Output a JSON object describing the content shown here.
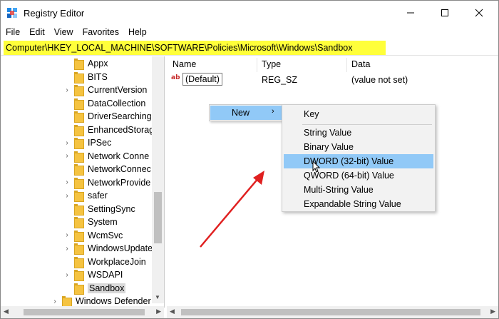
{
  "window": {
    "title": "Registry Editor"
  },
  "menubar": {
    "items": [
      "File",
      "Edit",
      "View",
      "Favorites",
      "Help"
    ]
  },
  "address": {
    "path": "Computer\\HKEY_LOCAL_MACHINE\\SOFTWARE\\Policies\\Microsoft\\Windows\\Sandbox",
    "highlight_color": "#ffff3a"
  },
  "tree": {
    "items": [
      {
        "label": "Appx",
        "expandable": false
      },
      {
        "label": "BITS",
        "expandable": false
      },
      {
        "label": "CurrentVersion",
        "expandable": true
      },
      {
        "label": "DataCollection",
        "expandable": false
      },
      {
        "label": "DriverSearching",
        "expandable": false
      },
      {
        "label": "EnhancedStorag",
        "expandable": false
      },
      {
        "label": "IPSec",
        "expandable": true
      },
      {
        "label": "Network Conne",
        "expandable": true
      },
      {
        "label": "NetworkConnec",
        "expandable": false
      },
      {
        "label": "NetworkProvide",
        "expandable": true
      },
      {
        "label": "safer",
        "expandable": true
      },
      {
        "label": "SettingSync",
        "expandable": false
      },
      {
        "label": "System",
        "expandable": false
      },
      {
        "label": "WcmSvc",
        "expandable": true
      },
      {
        "label": "WindowsUpdate",
        "expandable": true
      },
      {
        "label": "WorkplaceJoin",
        "expandable": false
      },
      {
        "label": "WSDAPI",
        "expandable": true
      },
      {
        "label": "Sandbox",
        "expandable": false,
        "selected": true
      },
      {
        "label": "Windows Defender",
        "expandable": true
      }
    ]
  },
  "columns": {
    "name": "Name",
    "type": "Type",
    "data": "Data"
  },
  "values": [
    {
      "icon": "string-value-icon",
      "icon_text": "ab",
      "name": "(Default)",
      "type": "REG_SZ",
      "data": "(value not set)"
    }
  ],
  "context_menu": {
    "parent_item": "New",
    "submenu": [
      "Key",
      "String Value",
      "Binary Value",
      "DWORD (32-bit) Value",
      "QWORD (64-bit) Value",
      "Multi-String Value",
      "Expandable String Value"
    ],
    "hovered": "DWORD (32-bit) Value",
    "highlight_color": "#91c9f7"
  },
  "annotation": {
    "arrow_color": "#e02020"
  }
}
